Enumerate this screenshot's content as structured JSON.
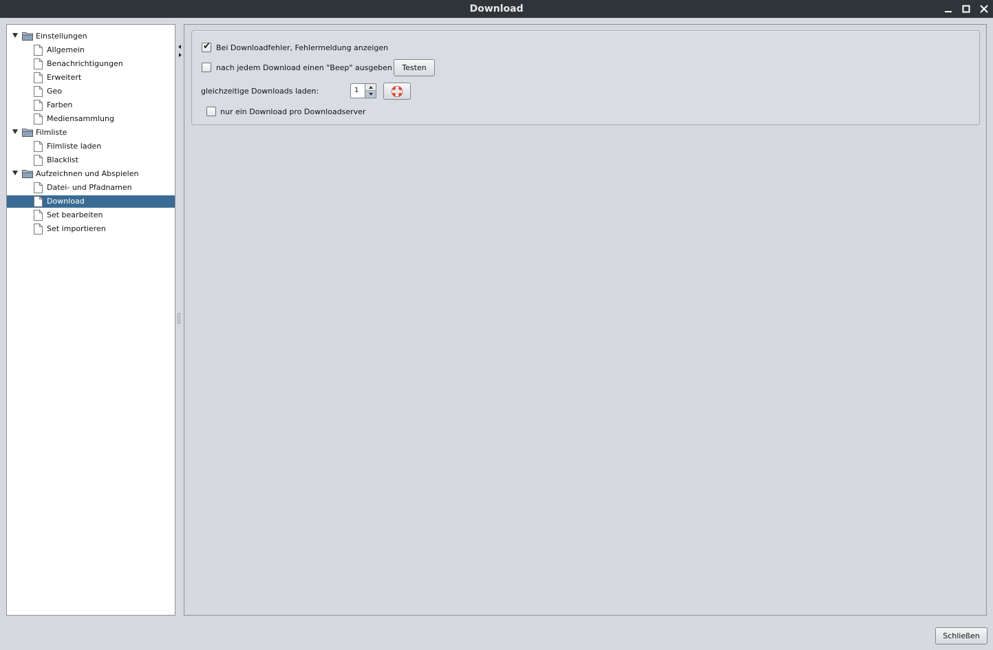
{
  "window": {
    "title": "Download"
  },
  "tree": {
    "items": [
      {
        "label": "Einstellungen",
        "type": "folder"
      },
      {
        "label": "Allgemein",
        "type": "leaf"
      },
      {
        "label": "Benachrichtigungen",
        "type": "leaf"
      },
      {
        "label": "Erweitert",
        "type": "leaf"
      },
      {
        "label": "Geo",
        "type": "leaf"
      },
      {
        "label": "Farben",
        "type": "leaf"
      },
      {
        "label": "Mediensammlung",
        "type": "leaf"
      },
      {
        "label": "Filmliste",
        "type": "folder"
      },
      {
        "label": "Filmliste laden",
        "type": "leaf"
      },
      {
        "label": "Blacklist",
        "type": "leaf"
      },
      {
        "label": "Aufzeichnen und Abspielen",
        "type": "folder"
      },
      {
        "label": "Datei- und Pfadnamen",
        "type": "leaf"
      },
      {
        "label": "Download",
        "type": "leaf",
        "selected": true
      },
      {
        "label": "Set bearbeiten",
        "type": "leaf"
      },
      {
        "label": "Set importieren",
        "type": "leaf"
      }
    ]
  },
  "settings": {
    "show_error_label": "Bei Downloadfehler, Fehlermeldung anzeigen",
    "show_error_checked": true,
    "beep_label": "nach jedem Download einen \"Beep\" ausgeben",
    "beep_checked": false,
    "test_button": "Testen",
    "concurrent_label": "gleichzeitige Downloads laden:",
    "concurrent_value": "1",
    "one_per_server_label": "nur ein Download pro Downloadserver",
    "one_per_server_checked": false
  },
  "footer": {
    "close_button": "Schließen"
  },
  "icons": {
    "reset": "lifebuoy-icon",
    "folder": "folder-icon",
    "leaf": "document-icon"
  },
  "colors": {
    "selection": "#3a6b94",
    "titlebar": "#2f3438",
    "background": "#d6d9df"
  }
}
